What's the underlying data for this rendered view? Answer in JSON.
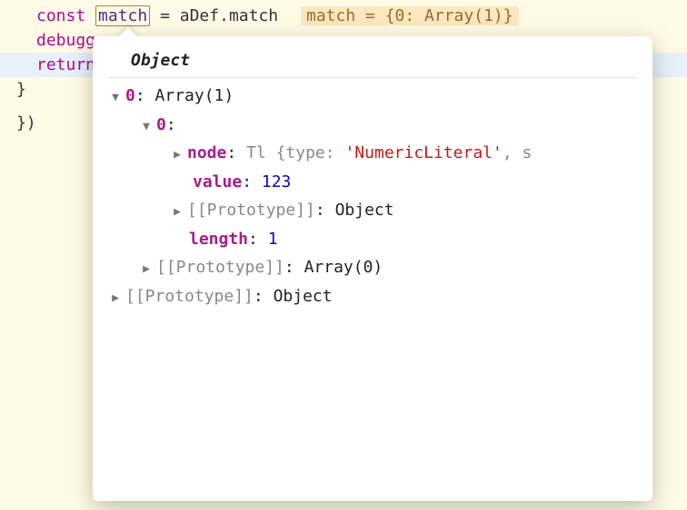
{
  "code": {
    "line1": {
      "const_kw": "const",
      "boxed": "match",
      "eq": "=",
      "obj": "aDef",
      "dot": ".",
      "prop": "match"
    },
    "inline_preview": {
      "var": "match",
      "eq": "=",
      "value": "{0: Array(1)}"
    },
    "line2": "debugger",
    "line3": "return",
    "line4": "}",
    "line5": "})"
  },
  "tooltip": {
    "title": "Object",
    "rows": {
      "r0_key": "0",
      "r0_val": "Array(1)",
      "r1_key": "0",
      "r2_key": "node",
      "r2_type": "Tl",
      "r2_brace_open": "{",
      "r2_propname": "type",
      "r2_propval": "'NumericLiteral'",
      "r2_tail": ", s",
      "r3_key": "value",
      "r3_val": "123",
      "r4_key": "[[Prototype]]",
      "r4_val": "Object",
      "r5_key": "length",
      "r5_val": "1",
      "r6_key": "[[Prototype]]",
      "r6_val": "Array(0)",
      "r7_key": "[[Prototype]]",
      "r7_val": "Object"
    }
  },
  "glyphs": {
    "expanded": "▼",
    "collapsed": "▶"
  }
}
